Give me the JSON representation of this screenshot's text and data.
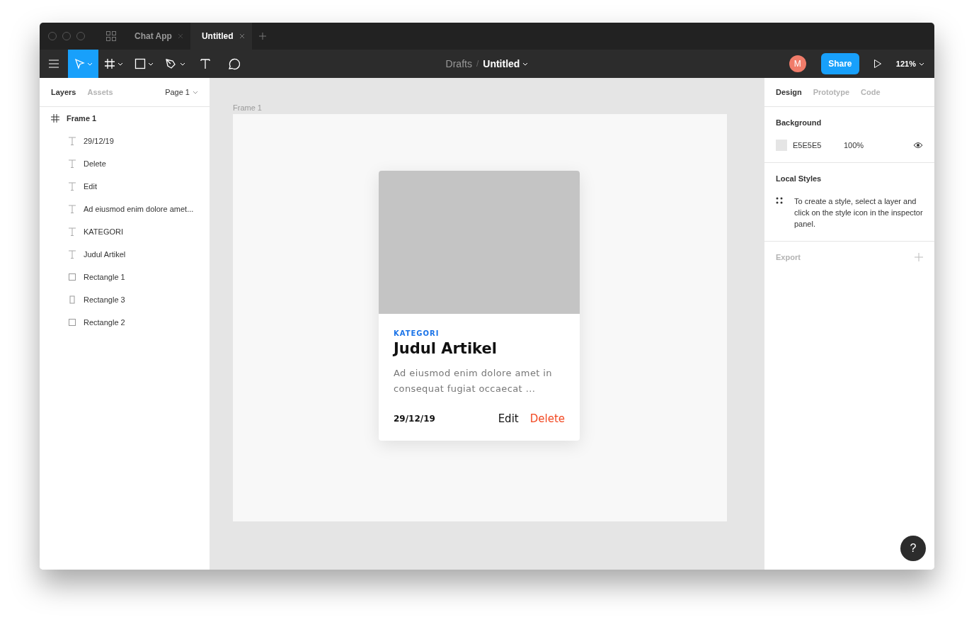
{
  "tabs": [
    {
      "label": "Chat App",
      "selected": false
    },
    {
      "label": "Untitled",
      "selected": true
    }
  ],
  "toolbar": {
    "tools": [
      {
        "kind": "move",
        "selected": true,
        "dropdown": true
      },
      {
        "kind": "frame",
        "selected": false,
        "dropdown": true
      },
      {
        "kind": "rect",
        "selected": false,
        "dropdown": true
      },
      {
        "kind": "pen",
        "selected": false,
        "dropdown": true
      },
      {
        "kind": "text",
        "selected": false,
        "dropdown": false
      },
      {
        "kind": "comment",
        "selected": false,
        "dropdown": false
      }
    ],
    "breadcrumb": {
      "folder": "Drafts",
      "separator": "/",
      "file": "Untitled"
    },
    "avatar": "M",
    "share": "Share",
    "zoom": "121%"
  },
  "left_panel": {
    "tabs": [
      {
        "label": "Layers",
        "selected": true
      },
      {
        "label": "Assets",
        "selected": false
      }
    ],
    "page": "Page 1",
    "layers": [
      {
        "kind": "frame",
        "name": "Frame 1",
        "children": [
          {
            "kind": "text",
            "name": "29/12/19"
          },
          {
            "kind": "text",
            "name": "Delete"
          },
          {
            "kind": "text",
            "name": "Edit"
          },
          {
            "kind": "text",
            "name": "Ad eiusmod enim dolore amet..."
          },
          {
            "kind": "text",
            "name": "KATEGORI"
          },
          {
            "kind": "text",
            "name": "Judul Artikel"
          },
          {
            "kind": "rect",
            "name": "Rectangle 1"
          },
          {
            "kind": "tall-rect",
            "name": "Rectangle 3"
          },
          {
            "kind": "rect",
            "name": "Rectangle 2"
          }
        ]
      }
    ]
  },
  "canvas": {
    "frame_label": "Frame 1",
    "card": {
      "category": "KATEGORI",
      "title": "Judul Artikel",
      "excerpt": "Ad eiusmod enim dolore amet in consequat fugiat occaecat ...",
      "date": "29/12/19",
      "edit": "Edit",
      "delete": "Delete"
    },
    "help": "?"
  },
  "right_panel": {
    "tabs": [
      {
        "label": "Design",
        "selected": true
      },
      {
        "label": "Prototype",
        "selected": false
      },
      {
        "label": "Code",
        "selected": false
      }
    ],
    "background": {
      "heading": "Background",
      "color": "#e5e5e5",
      "hex": "E5E5E5",
      "opacity": "100%"
    },
    "local_styles": {
      "heading": "Local Styles",
      "text": "To create a style, select a layer and click on the style icon in the inspector panel."
    },
    "export": {
      "heading": "Export"
    }
  }
}
